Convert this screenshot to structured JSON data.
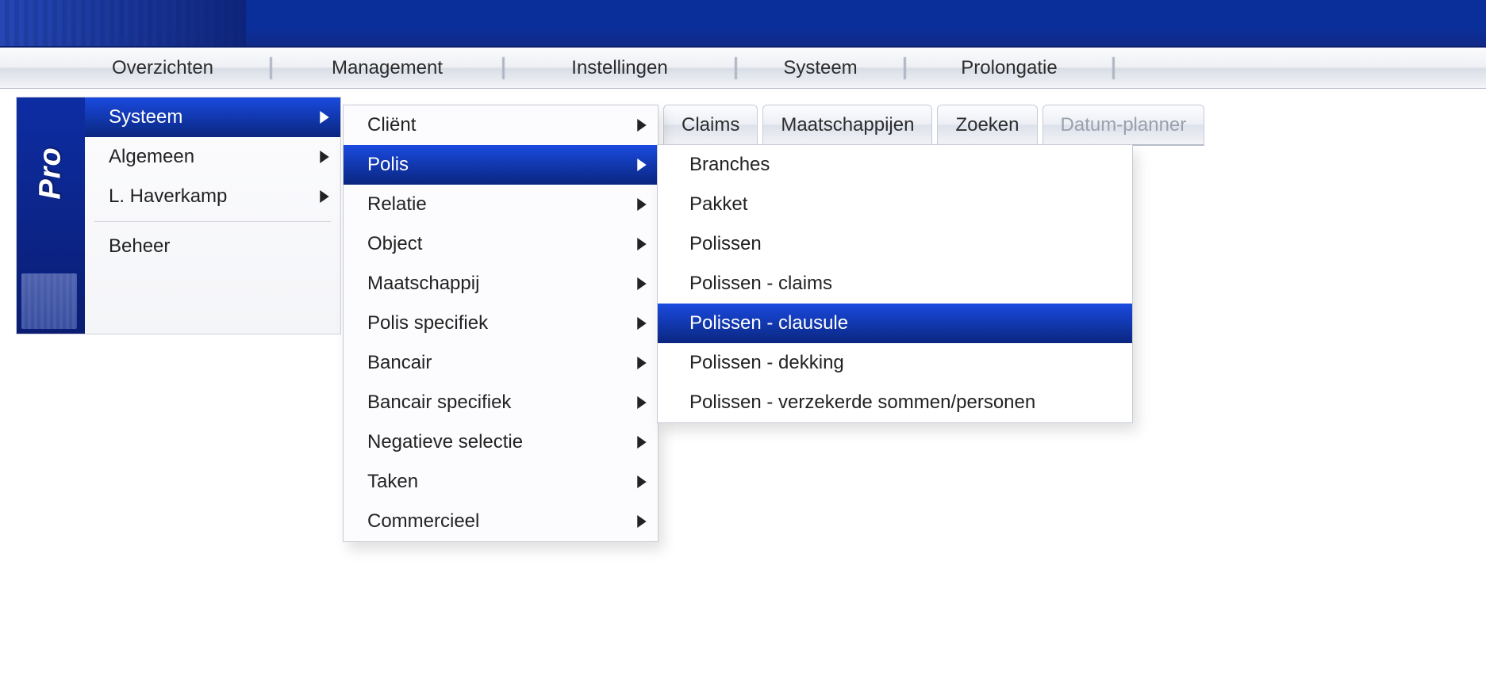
{
  "brand_stripe_text": "Pro",
  "menubar": {
    "items": [
      "Overzichten",
      "Management",
      "Instellingen",
      "Systeem",
      "Prolongatie"
    ]
  },
  "tabs": {
    "items": [
      {
        "label": "Claims",
        "disabled": false
      },
      {
        "label": "Maatschappijen",
        "disabled": false
      },
      {
        "label": "Zoeken",
        "disabled": false
      },
      {
        "label": "Datum-planner",
        "disabled": true
      }
    ]
  },
  "menu_level1": {
    "items": [
      {
        "label": "Systeem",
        "has_submenu": true,
        "selected": true
      },
      {
        "label": "Algemeen",
        "has_submenu": true,
        "selected": false
      },
      {
        "label": "L. Haverkamp",
        "has_submenu": true,
        "selected": false
      }
    ],
    "after_sep_items": [
      {
        "label": "Beheer",
        "has_submenu": false,
        "selected": false
      }
    ]
  },
  "menu_level2": {
    "items": [
      {
        "label": "Cliënt",
        "has_submenu": true,
        "selected": false
      },
      {
        "label": "Polis",
        "has_submenu": true,
        "selected": true
      },
      {
        "label": "Relatie",
        "has_submenu": true,
        "selected": false
      },
      {
        "label": "Object",
        "has_submenu": true,
        "selected": false
      },
      {
        "label": "Maatschappij",
        "has_submenu": true,
        "selected": false
      },
      {
        "label": "Polis specifiek",
        "has_submenu": true,
        "selected": false
      },
      {
        "label": "Bancair",
        "has_submenu": true,
        "selected": false
      },
      {
        "label": "Bancair specifiek",
        "has_submenu": true,
        "selected": false
      },
      {
        "label": "Negatieve selectie",
        "has_submenu": true,
        "selected": false
      },
      {
        "label": "Taken",
        "has_submenu": true,
        "selected": false
      },
      {
        "label": "Commercieel",
        "has_submenu": true,
        "selected": false
      }
    ]
  },
  "menu_level3": {
    "items": [
      {
        "label": "Branches",
        "selected": false
      },
      {
        "label": "Pakket",
        "selected": false
      },
      {
        "label": "Polissen",
        "selected": false
      },
      {
        "label": "Polissen - claims",
        "selected": false
      },
      {
        "label": "Polissen - clausule",
        "selected": true
      },
      {
        "label": "Polissen - dekking",
        "selected": false
      },
      {
        "label": "Polissen - verzekerde sommen/personen",
        "selected": false
      }
    ]
  }
}
